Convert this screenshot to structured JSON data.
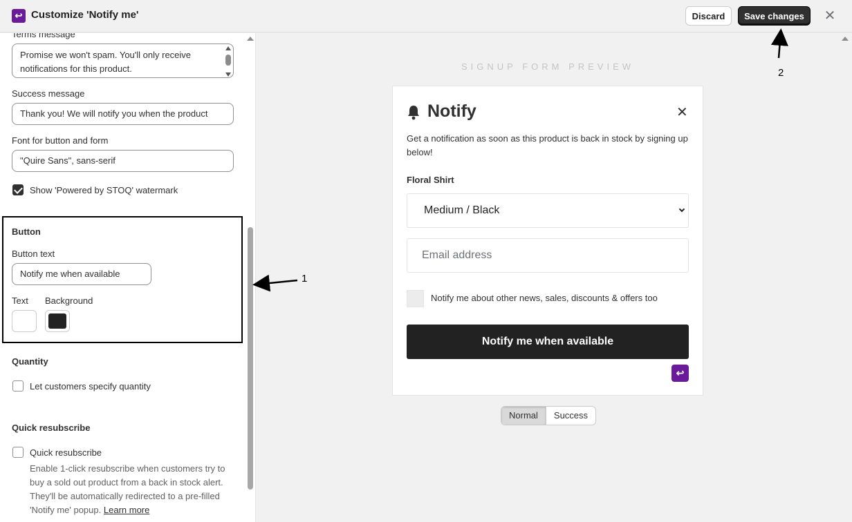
{
  "header": {
    "title": "Customize 'Notify me'",
    "discard_label": "Discard",
    "save_label": "Save changes",
    "close_glyph": "✕",
    "logo_glyph": "↩"
  },
  "settings": {
    "terms": {
      "label": "Terms message",
      "value": "Promise we won't spam. You'll only receive notifications for this product."
    },
    "success": {
      "label": "Success message",
      "value": "Thank you! We will notify you when the product"
    },
    "font": {
      "label": "Font for button and form",
      "value": "\"Quire Sans\", sans-serif"
    },
    "watermark": {
      "label": "Show 'Powered by STOQ' watermark",
      "checked": true
    },
    "button": {
      "section_title": "Button",
      "text_label": "Button text",
      "text_value": "Notify me when available",
      "text_color_label": "Text",
      "background_label": "Background",
      "text_color": "#ffffff",
      "background_color": "#222222"
    },
    "quantity": {
      "section_title": "Quantity",
      "checkbox_label": "Let customers specify quantity",
      "checked": false
    },
    "resubscribe": {
      "section_title": "Quick resubscribe",
      "checkbox_label": "Quick resubscribe",
      "checked": false,
      "help_text": "Enable 1-click resubscribe when customers try to buy a sold out product from a back in stock alert. They'll be automatically redirected to a pre-filled 'Notify me' popup.",
      "learn_more": "Learn more"
    }
  },
  "preview": {
    "heading": "SIGNUP FORM PREVIEW",
    "card": {
      "title": "Notify",
      "close_glyph": "✕",
      "description": "Get a notification as soon as this product is back in stock by signing up below!",
      "product_name": "Floral Shirt",
      "variant": "Medium / Black",
      "email_placeholder": "Email address",
      "optin_label": "Notify me about other news, sales, discounts & offers too",
      "button_label": "Notify me when available",
      "logo_glyph": "↩"
    },
    "modes": [
      "Normal",
      "Success"
    ],
    "active_mode": "Normal"
  },
  "annotations": {
    "marker_1": "1",
    "marker_2": "2"
  },
  "colors": {
    "brand": "#6a1b9a",
    "primary_button": "#303030",
    "notify_button": "#222222"
  }
}
